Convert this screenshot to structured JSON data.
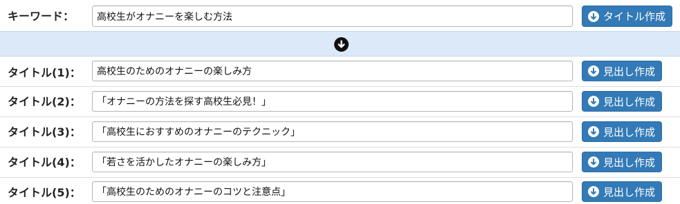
{
  "keyword": {
    "label": "キーワード：",
    "value": "高校生がオナニーを楽しむ方法",
    "button_label": "タイトル作成"
  },
  "divider": {
    "icon": "arrow-circle-down-icon"
  },
  "titles": [
    {
      "label": "タイトル(1)：",
      "value": "高校生のためのオナニーの楽しみ方",
      "button_label": "見出し作成"
    },
    {
      "label": "タイトル(2)：",
      "value": "「オナニーの方法を探す高校生必見！」",
      "button_label": "見出し作成"
    },
    {
      "label": "タイトル(3)：",
      "value": "「高校生におすすめのオナニーのテクニック」",
      "button_label": "見出し作成"
    },
    {
      "label": "タイトル(4)：",
      "value": "「若さを活かしたオナニーの楽しみ方」",
      "button_label": "見出し作成"
    },
    {
      "label": "タイトル(5)：",
      "value": "「高校生のためのオナニーのコツと注意点」",
      "button_label": "見出し作成"
    }
  ],
  "colors": {
    "button_bg": "#337ab7",
    "band_bg": "#dce9f8",
    "border": "#dcdcdc"
  }
}
